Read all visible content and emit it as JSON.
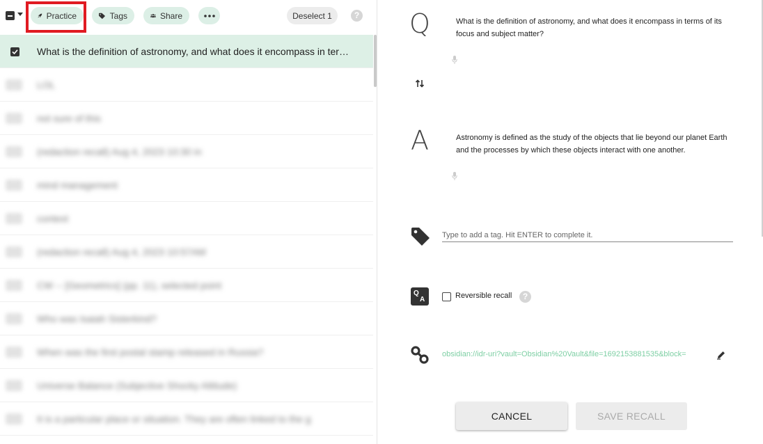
{
  "toolbar": {
    "practice_label": "Practice",
    "tags_label": "Tags",
    "share_label": "Share",
    "deselect_label": "Deselect 1",
    "help_label": "?"
  },
  "list": {
    "rows": [
      {
        "text": "What is the definition of astronomy, and what does it encompass in terms of its focus and subject matter?",
        "selected": true
      },
      {
        "text": "LOL",
        "selected": false
      },
      {
        "text": "not sure of this",
        "selected": false
      },
      {
        "text": "(redaction recall) Aug 4, 2023 10:30 in",
        "selected": false
      },
      {
        "text": "mind management",
        "selected": false
      },
      {
        "text": "context",
        "selected": false
      },
      {
        "text": "(redaction recall) Aug 4, 2023 10:57AM",
        "selected": false
      },
      {
        "text": "CW -- [Geometrics] (pp. 11), selected point",
        "selected": false
      },
      {
        "text": "Who was Isaiah Sisterkind?",
        "selected": false
      },
      {
        "text": "When was the first postal stamp released in Russia?",
        "selected": false
      },
      {
        "text": "Universe Balance (Subjective Shocky Altitude)",
        "selected": false
      },
      {
        "text": "It is a particular place or situation. They are often linked to the g",
        "selected": false
      }
    ]
  },
  "recall": {
    "question_letter": "Q",
    "question": "What is the definition of astronomy, and what does it encompass in terms of its focus and subject matter?",
    "answer_letter": "A",
    "answer": "Astronomy is defined as the study of the objects that lie beyond our planet Earth and the processes by which these objects interact with one another.",
    "tag_placeholder": "Type to add a tag. Hit ENTER to complete it.",
    "reversible_label": "Reversible recall",
    "reversible_checked": false,
    "qa_icon_q": "Q",
    "qa_icon_a": "A",
    "link": "obsidian://idr-uri?vault=Obsidian%20Vault&file=1692153881535&block=",
    "cancel_label": "CANCEL",
    "save_label": "SAVE RECALL"
  },
  "colors": {
    "accent_pill": "#dcefe6",
    "selected_row": "#ddf0e6",
    "link": "#7ecfa4",
    "highlight": "#e01b22"
  }
}
